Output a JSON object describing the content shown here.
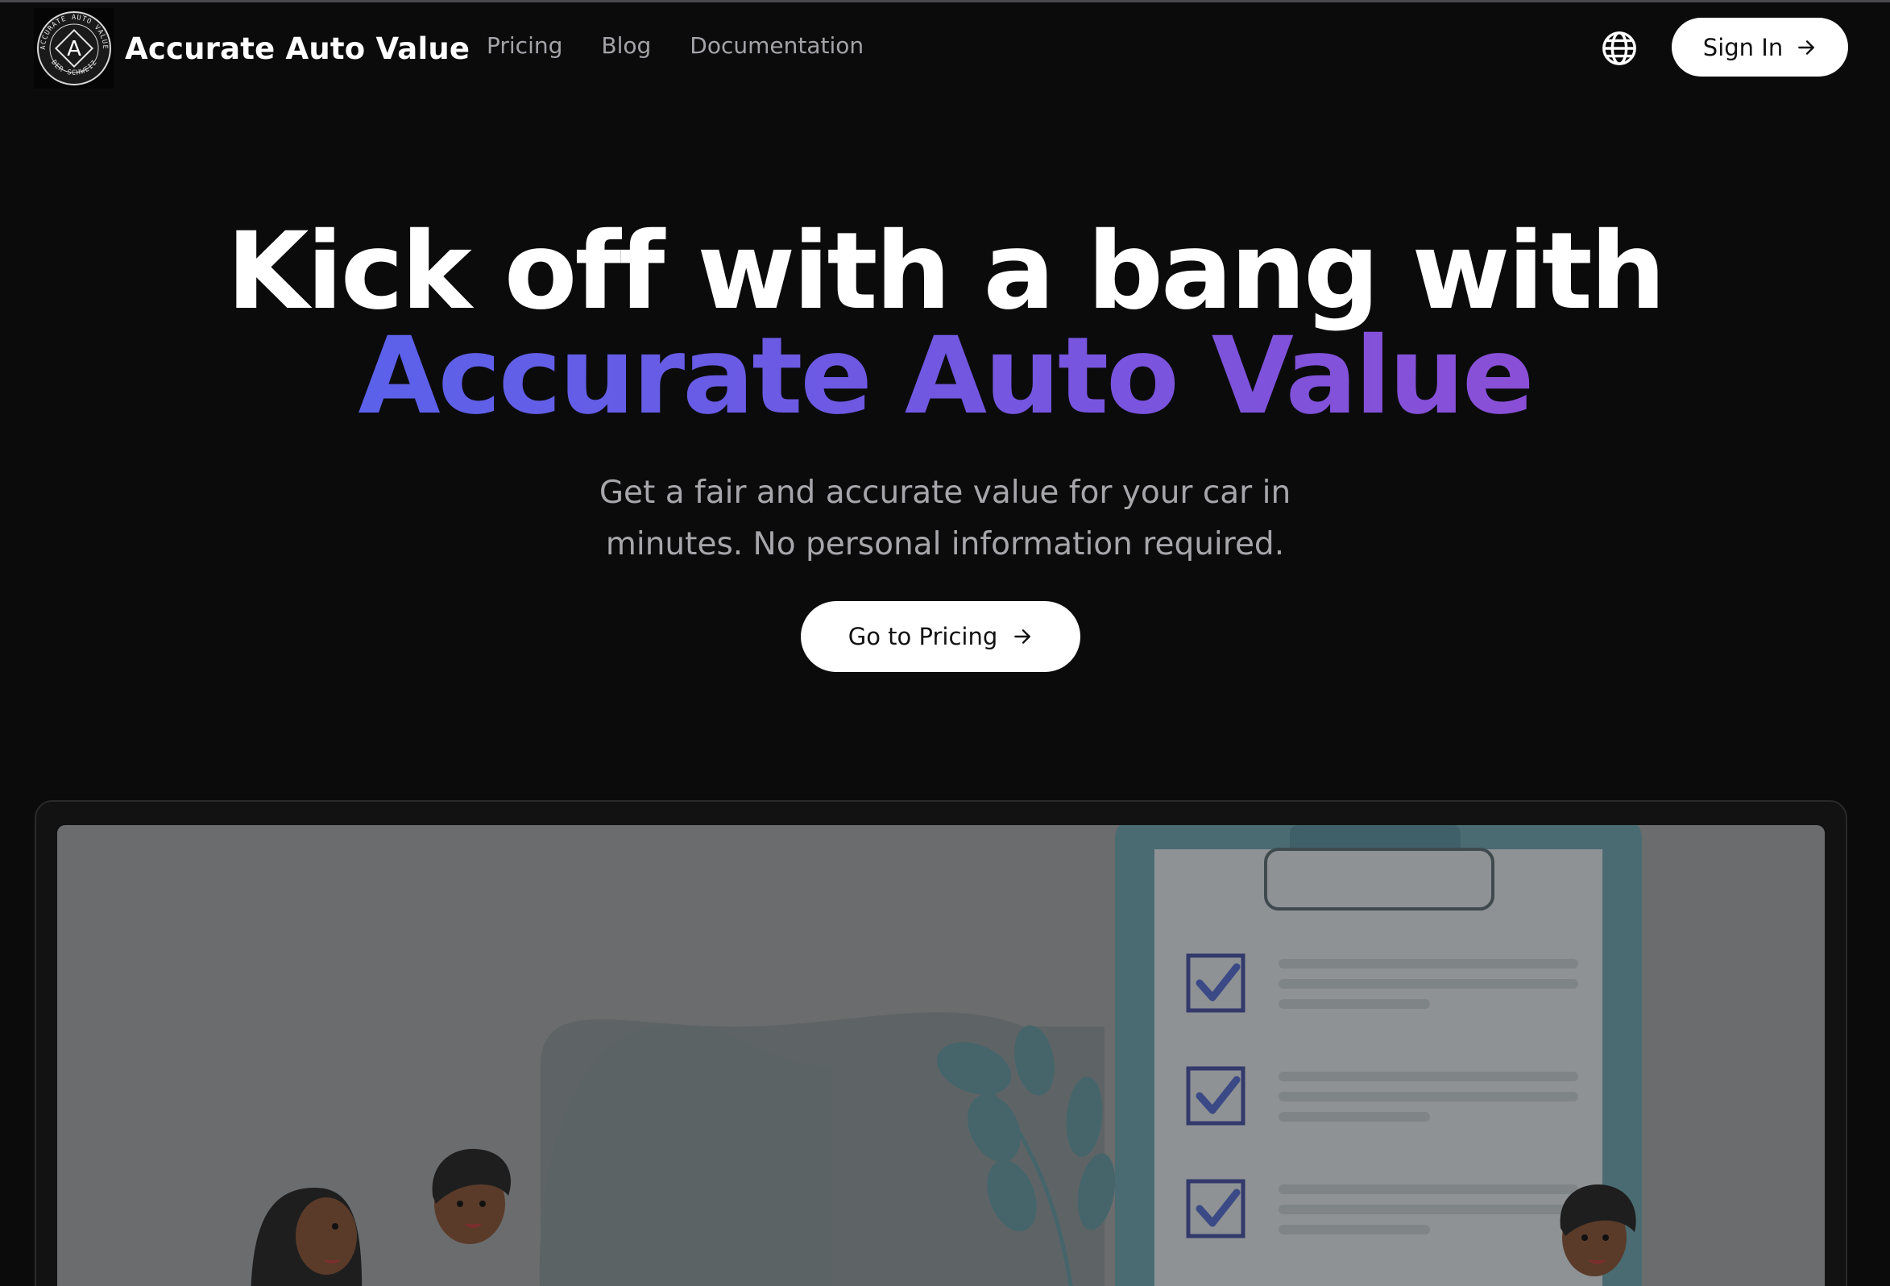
{
  "header": {
    "brand_name": "Accurate Auto Value",
    "logo": {
      "letter": "A",
      "ring_text_top": "ACCURATE AUTO VALUE",
      "ring_text_bottom": "DER SCHWEIZ"
    },
    "nav": [
      {
        "label": "Pricing"
      },
      {
        "label": "Blog"
      },
      {
        "label": "Documentation"
      }
    ],
    "language_icon": "globe-icon",
    "sign_in_label": "Sign In"
  },
  "hero": {
    "title_line1": "Kick off with a bang with",
    "title_line2": "Accurate Auto Value",
    "subtitle": "Get a fair and accurate value for your car in minutes. No personal information required.",
    "cta_label": "Go to Pricing"
  },
  "colors": {
    "background": "#0b0b0c",
    "gradient_start": "#5b61ea",
    "gradient_end": "#8a4fd6",
    "nav_text": "#a3a3a8",
    "button_bg": "#ffffff"
  },
  "preview": {
    "illustration": "clipboard-checklist-illustration",
    "checkbox_count": 3
  }
}
